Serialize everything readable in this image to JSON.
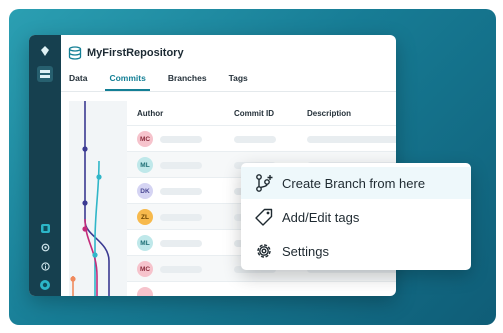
{
  "window": {
    "title": "MyFirstRepository"
  },
  "tabs": [
    {
      "label": "Data",
      "active": false
    },
    {
      "label": "Commits",
      "active": true
    },
    {
      "label": "Branches",
      "active": false
    },
    {
      "label": "Tags",
      "active": false
    }
  ],
  "table": {
    "columns": [
      "Author",
      "Commit ID",
      "Description"
    ],
    "rows": [
      {
        "initials": "MC",
        "bg": "#f6c3cc",
        "fg": "#8a2b3c"
      },
      {
        "initials": "ML",
        "bg": "#bfe8ea",
        "fg": "#1c6d74"
      },
      {
        "initials": "DK",
        "bg": "#d5d4f3",
        "fg": "#4a4794"
      },
      {
        "initials": "ZL",
        "bg": "#f7b94c",
        "fg": "#6b4300"
      },
      {
        "initials": "ML",
        "bg": "#bfe8ea",
        "fg": "#1c6d74"
      },
      {
        "initials": "MC",
        "bg": "#f6c3cc",
        "fg": "#8a2b3c"
      }
    ]
  },
  "context_menu": {
    "items": [
      {
        "label": "Create Branch from here",
        "icon": "git-branch-plus-icon"
      },
      {
        "label": "Add/Edit tags",
        "icon": "tag-icon"
      },
      {
        "label": "Settings",
        "icon": "gear-icon"
      }
    ]
  },
  "colors": {
    "accent": "#137f95",
    "rail": "#16404f",
    "branch_blue": "#3b3a92",
    "branch_teal": "#30b6c8",
    "branch_pink": "#c42c7a",
    "branch_orange": "#f08a5d"
  }
}
